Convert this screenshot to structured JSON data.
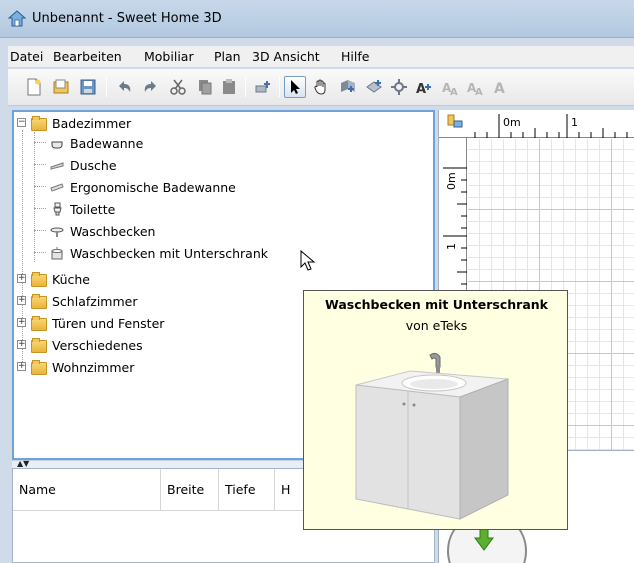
{
  "window": {
    "title": "Unbenannt - Sweet Home 3D"
  },
  "menu": [
    "Datei",
    "Bearbeiten",
    "Mobiliar",
    "Plan",
    "3D Ansicht",
    "Hilfe"
  ],
  "tree": {
    "categories": [
      {
        "label": "Badezimmer",
        "expanded": true,
        "items": [
          {
            "label": "Badewanne",
            "icon": "bathtub-icon"
          },
          {
            "label": "Dusche",
            "icon": "shower-icon"
          },
          {
            "label": "Ergonomische Badewanne",
            "icon": "ergonomic-bathtub-icon"
          },
          {
            "label": "Toilette",
            "icon": "toilet-icon"
          },
          {
            "label": "Waschbecken",
            "icon": "washbasin-icon"
          },
          {
            "label": "Waschbecken mit Unterschrank",
            "icon": "washbasin-cabinet-icon"
          }
        ]
      },
      {
        "label": "Küche",
        "expanded": false
      },
      {
        "label": "Schlafzimmer",
        "expanded": false
      },
      {
        "label": "Türen und Fenster",
        "expanded": false
      },
      {
        "label": "Verschiedenes",
        "expanded": false
      },
      {
        "label": "Wohnzimmer",
        "expanded": false
      }
    ]
  },
  "table": {
    "columns": [
      "Name",
      "Breite",
      "Tiefe",
      "H"
    ]
  },
  "plan": {
    "ruler_top": [
      "0m",
      "1"
    ],
    "ruler_left": [
      "0m",
      "1"
    ]
  },
  "tooltip": {
    "title": "Waschbecken mit Unterschrank",
    "subtitle": "von eTeks"
  },
  "colors": {
    "selection_border": "#6ea2d8",
    "tooltip_bg": "#ffffe1",
    "nav_arrow": "#5cb030"
  }
}
